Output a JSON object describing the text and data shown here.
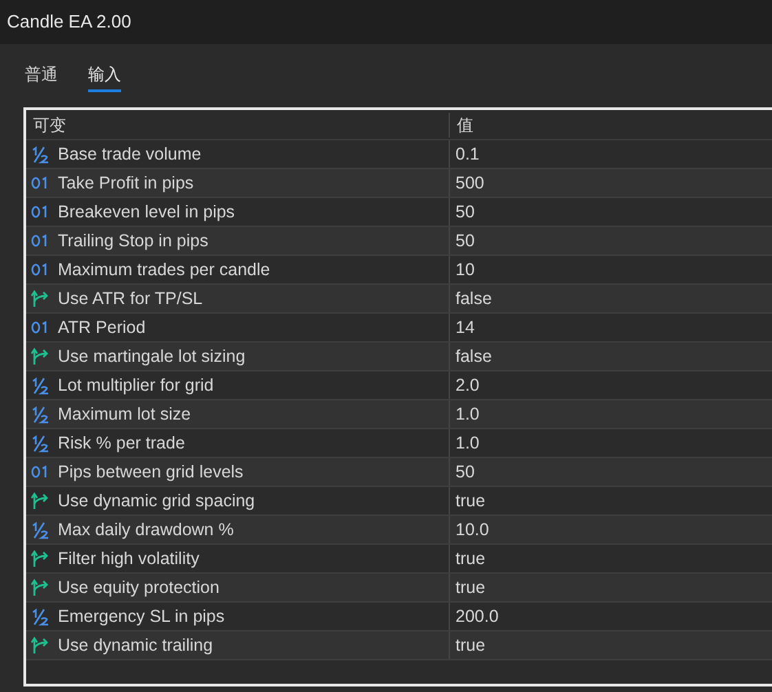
{
  "window": {
    "title": "Candle EA 2.00"
  },
  "tabs": [
    {
      "label": "普通",
      "selected": false
    },
    {
      "label": "输入",
      "selected": true
    }
  ],
  "table": {
    "columns": [
      "可变",
      "值"
    ],
    "rows": [
      {
        "kind": "double",
        "name": "Base trade volume",
        "value": "0.1"
      },
      {
        "kind": "int",
        "name": "Take Profit in pips",
        "value": "500"
      },
      {
        "kind": "int",
        "name": "Breakeven level in pips",
        "value": "50"
      },
      {
        "kind": "int",
        "name": "Trailing Stop in pips",
        "value": "50"
      },
      {
        "kind": "int",
        "name": "Maximum trades per candle",
        "value": "10"
      },
      {
        "kind": "bool",
        "name": "Use ATR for TP/SL",
        "value": "false"
      },
      {
        "kind": "int",
        "name": "ATR Period",
        "value": "14"
      },
      {
        "kind": "bool",
        "name": "Use martingale lot sizing",
        "value": "false"
      },
      {
        "kind": "double",
        "name": "Lot multiplier for grid",
        "value": "2.0"
      },
      {
        "kind": "double",
        "name": "Maximum lot size",
        "value": "1.0"
      },
      {
        "kind": "double",
        "name": "Risk % per trade",
        "value": "1.0"
      },
      {
        "kind": "int",
        "name": "Pips between grid levels",
        "value": "50"
      },
      {
        "kind": "bool",
        "name": "Use dynamic grid spacing",
        "value": "true"
      },
      {
        "kind": "double",
        "name": "Max daily drawdown %",
        "value": "10.0"
      },
      {
        "kind": "bool",
        "name": "Filter high volatility",
        "value": "true"
      },
      {
        "kind": "bool",
        "name": "Use equity protection",
        "value": "true"
      },
      {
        "kind": "double",
        "name": "Emergency SL in pips",
        "value": "200.0"
      },
      {
        "kind": "bool",
        "name": "Use dynamic trailing",
        "value": "true"
      }
    ]
  }
}
